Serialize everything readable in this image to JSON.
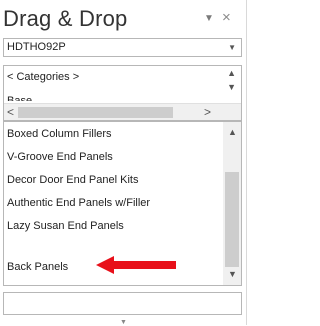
{
  "panel": {
    "title": "Drag & Drop",
    "pin_icon": "▼",
    "close_icon": "×"
  },
  "catalog_select": {
    "value": "HDTHO92P",
    "arrow": "▼"
  },
  "categories": {
    "nav_label": "< Categories >",
    "partial_item": "Base",
    "up_icon": "▲",
    "down_icon": "▼",
    "left_icon": "<",
    "right_icon": ">"
  },
  "items": [
    "Boxed Column Fillers",
    "V-Groove End Panels",
    "Decor Door End Panel Kits",
    "Authentic End Panels w/Filler",
    "Lazy Susan End Panels",
    "",
    "Back Panels"
  ],
  "list_scroll": {
    "up_icon": "▲",
    "down_icon": "▼"
  },
  "colors": {
    "arrow": "#e8101a"
  },
  "grip_icon": "▼"
}
